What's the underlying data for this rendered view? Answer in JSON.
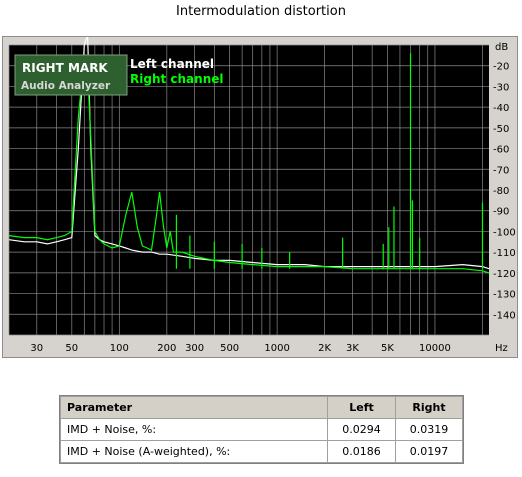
{
  "title": "Intermodulation distortion",
  "logo": {
    "line1": "RIGHT MARK",
    "line2": "Audio Analyzer"
  },
  "colors": {
    "plot_bg": "#000000",
    "grid": "#8a8a8a",
    "left": "#ffffff",
    "right": "#00ff00",
    "frame": "#d6d3ce"
  },
  "chart_data": {
    "type": "line",
    "title": "Intermodulation distortion",
    "xlabel": "Hz",
    "ylabel": "dB",
    "x_scale": "log",
    "xlim": [
      20,
      22000
    ],
    "ylim": [
      -150,
      -10
    ],
    "grid": true,
    "legend_position": "top-left",
    "x_ticks": [
      30,
      50,
      100,
      200,
      300,
      500,
      1000,
      2000,
      3000,
      5000,
      10000
    ],
    "x_tick_labels": [
      "30",
      "50",
      "100",
      "200",
      "300",
      "500",
      "1000",
      "2K",
      "3K",
      "5K",
      "10000"
    ],
    "y_ticks": [
      -20,
      -30,
      -40,
      -50,
      -60,
      -70,
      -80,
      -90,
      -100,
      -110,
      -120,
      -130,
      -140
    ],
    "series": [
      {
        "name": "Left channel",
        "x": [
          20,
          25,
          30,
          35,
          40,
          45,
          50,
          55,
          60,
          63,
          66,
          70,
          75,
          80,
          90,
          100,
          110,
          120,
          140,
          160,
          180,
          200,
          250,
          300,
          400,
          500,
          700,
          1000,
          1500,
          2000,
          3000,
          5000,
          7000,
          10000,
          15000,
          20000,
          22000
        ],
        "y": [
          -104,
          -105,
          -105,
          -106,
          -105,
          -104,
          -103,
          -60,
          -10,
          -5,
          -60,
          -102,
          -104,
          -105,
          -106,
          -107,
          -108,
          -109,
          -110,
          -110,
          -111,
          -111,
          -112,
          -113,
          -114,
          -114,
          -115,
          -116,
          -116,
          -117,
          -117,
          -117,
          -117,
          -117,
          -116,
          -117,
          -118
        ]
      },
      {
        "name": "Right channel",
        "x": [
          20,
          25,
          30,
          35,
          40,
          45,
          50,
          55,
          60,
          63,
          66,
          70,
          75,
          80,
          90,
          100,
          110,
          120,
          130,
          140,
          150,
          160,
          170,
          180,
          190,
          200,
          210,
          220,
          250,
          300,
          400,
          500,
          700,
          1000,
          1500,
          2000,
          3000,
          5000,
          7000,
          10000,
          15000,
          20000,
          22000
        ],
        "y": [
          -102,
          -103,
          -103,
          -104,
          -103,
          -102,
          -100,
          -45,
          -15,
          -22,
          -55,
          -100,
          -104,
          -106,
          -108,
          -107,
          -92,
          -81,
          -98,
          -107,
          -108,
          -109,
          -95,
          -81,
          -97,
          -108,
          -100,
          -110,
          -110,
          -112,
          -114,
          -115,
          -116,
          -117,
          -117,
          -117,
          -118,
          -118,
          -118,
          -118,
          -118,
          -119,
          -120
        ]
      }
    ],
    "peaks": [
      {
        "series": "Right channel",
        "x": 230,
        "y": -92
      },
      {
        "series": "Right channel",
        "x": 280,
        "y": -102
      },
      {
        "series": "Right channel",
        "x": 400,
        "y": -105
      },
      {
        "series": "Right channel",
        "x": 600,
        "y": -106
      },
      {
        "series": "Right channel",
        "x": 800,
        "y": -108
      },
      {
        "series": "Right channel",
        "x": 1200,
        "y": -110
      },
      {
        "series": "Right channel",
        "x": 2600,
        "y": -103
      },
      {
        "series": "Right channel",
        "x": 4700,
        "y": -106
      },
      {
        "series": "Right channel",
        "x": 5100,
        "y": -98
      },
      {
        "series": "Right channel",
        "x": 5500,
        "y": -88
      },
      {
        "series": "Right channel",
        "x": 7000,
        "y": -14
      },
      {
        "series": "Right channel",
        "x": 7200,
        "y": -85
      },
      {
        "series": "Right channel",
        "x": 8000,
        "y": -103
      },
      {
        "series": "Right channel",
        "x": 20000,
        "y": -86
      }
    ]
  },
  "table": {
    "headers": [
      "Parameter",
      "Left",
      "Right"
    ],
    "rows": [
      [
        "IMD + Noise, %:",
        "0.0294",
        "0.0319"
      ],
      [
        "IMD + Noise (A-weighted), %:",
        "0.0186",
        "0.0197"
      ]
    ]
  }
}
